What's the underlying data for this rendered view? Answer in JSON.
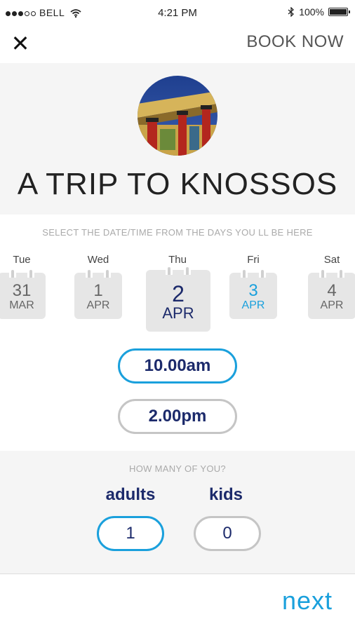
{
  "status_bar": {
    "carrier": "BELL",
    "time": "4:21 PM",
    "battery": "100%"
  },
  "header": {
    "book_now": "BOOK NOW"
  },
  "title": "A TRIP TO KNOSSOS",
  "date_section": {
    "label": "SELECT THE DATE/TIME FROM THE DAYS YOU LL BE HERE",
    "days": [
      {
        "day": "Tue",
        "date": "31",
        "month": "MAR"
      },
      {
        "day": "Wed",
        "date": "1",
        "month": "APR"
      },
      {
        "day": "Thu",
        "date": "2",
        "month": "APR"
      },
      {
        "day": "Fri",
        "date": "3",
        "month": "APR"
      },
      {
        "day": "Sat",
        "date": "4",
        "month": "APR"
      }
    ],
    "times": [
      "10.00am",
      "2.00pm"
    ]
  },
  "people": {
    "label": "HOW MANY OF YOU?",
    "adults_label": "adults",
    "kids_label": "kids",
    "adults_value": "1",
    "kids_value": "0"
  },
  "footer": {
    "next": "next"
  },
  "colors": {
    "accent": "#1aa0dc",
    "navy": "#1c2a6b",
    "grey_border": "#c5c5c5"
  },
  "icons": [
    "signal-dots-icon",
    "wifi-icon",
    "bluetooth-icon",
    "battery-icon",
    "close-icon",
    "calendar-icon"
  ]
}
